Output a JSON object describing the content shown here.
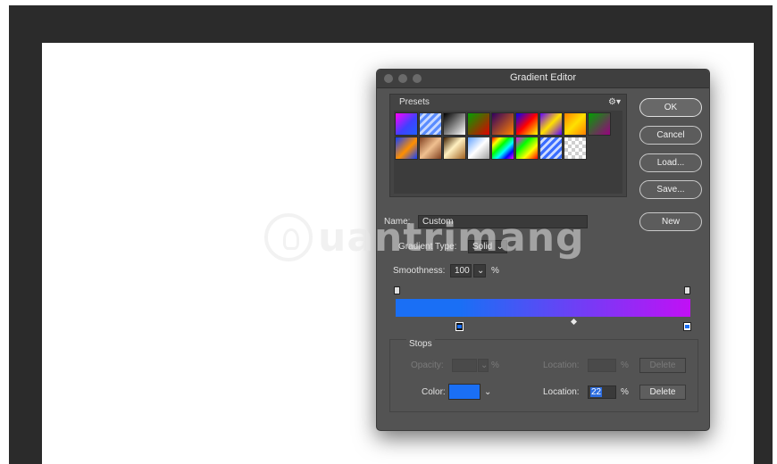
{
  "dialog": {
    "title": "Gradient Editor",
    "presets_label": "Presets",
    "buttons": {
      "ok": "OK",
      "cancel": "Cancel",
      "load": "Load...",
      "save": "Save...",
      "new": "New"
    },
    "name_label": "Name:",
    "name_value": "Custom",
    "gradient_type_label": "Gradient Type:",
    "gradient_type_value": "Solid",
    "smoothness_label": "Smoothness:",
    "smoothness_value": "100",
    "smoothness_unit": "%",
    "gradient": {
      "start_color": "#1a6ff5",
      "end_color": "#c110f5",
      "start_location_percent": 22
    },
    "stops": {
      "group_label": "Stops",
      "opacity_label": "Opacity:",
      "opacity_value": "",
      "opacity_unit": "%",
      "opacity_location_label": "Location:",
      "opacity_location_value": "",
      "opacity_location_unit": "%",
      "opacity_delete": "Delete",
      "color_label": "Color:",
      "color_value": "#1a6ff5",
      "color_location_label": "Location:",
      "color_location_value": "22",
      "color_location_unit": "%",
      "color_delete": "Delete"
    }
  },
  "watermark": {
    "text": "uantrimang"
  }
}
